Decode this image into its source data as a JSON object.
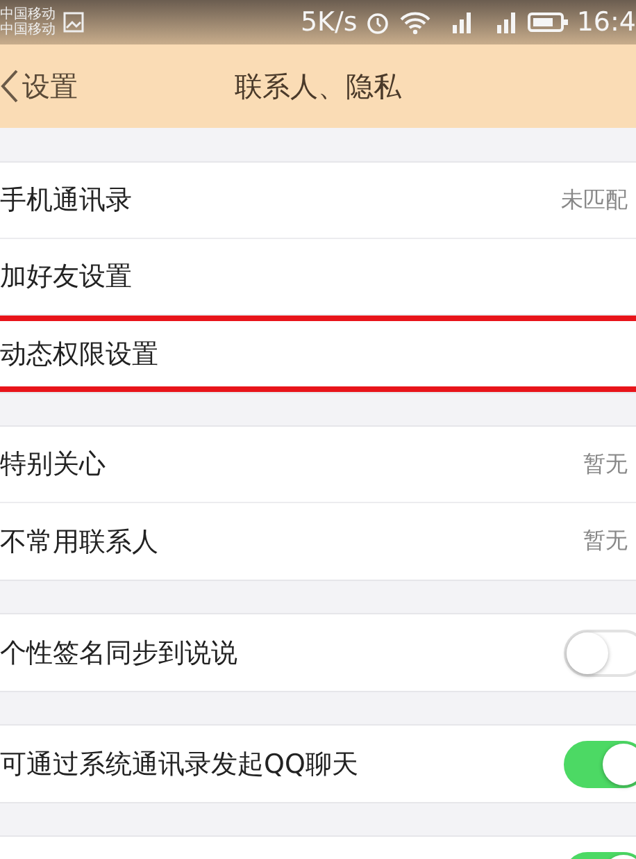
{
  "status_bar": {
    "carriers": [
      "中国移动",
      "中国移动"
    ],
    "speed": "5K/s",
    "time": "16:4"
  },
  "nav": {
    "back": "设置",
    "title": "联系人、隐私"
  },
  "groups": [
    {
      "items": [
        {
          "kind": "value",
          "label": "手机通讯录",
          "value": "未匹配",
          "highlighted": false
        },
        {
          "kind": "plain",
          "label": "加好友设置",
          "highlighted": false
        },
        {
          "kind": "plain",
          "label": "动态权限设置",
          "highlighted": true
        }
      ]
    },
    {
      "items": [
        {
          "kind": "value",
          "label": "特别关心",
          "value": "暂无",
          "highlighted": false
        },
        {
          "kind": "value",
          "label": "不常用联系人",
          "value": "暂无",
          "highlighted": false
        }
      ]
    },
    {
      "items": [
        {
          "kind": "toggle",
          "label": "个性签名同步到说说",
          "on": false,
          "highlighted": false
        }
      ]
    },
    {
      "items": [
        {
          "kind": "toggle",
          "label": "可通过系统通讯录发起QQ聊天",
          "on": true,
          "highlighted": false
        }
      ]
    },
    {
      "items": [
        {
          "kind": "toggle",
          "on": true
        }
      ]
    }
  ]
}
